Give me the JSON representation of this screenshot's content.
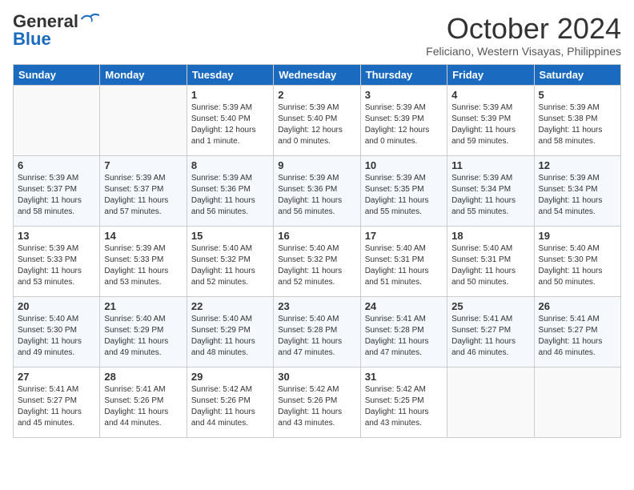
{
  "header": {
    "logo_line1": "General",
    "logo_line2": "Blue",
    "month_year": "October 2024",
    "location": "Feliciano, Western Visayas, Philippines"
  },
  "weekdays": [
    "Sunday",
    "Monday",
    "Tuesday",
    "Wednesday",
    "Thursday",
    "Friday",
    "Saturday"
  ],
  "weeks": [
    [
      {
        "day": "",
        "info": ""
      },
      {
        "day": "",
        "info": ""
      },
      {
        "day": "1",
        "info": "Sunrise: 5:39 AM\nSunset: 5:40 PM\nDaylight: 12 hours\nand 1 minute."
      },
      {
        "day": "2",
        "info": "Sunrise: 5:39 AM\nSunset: 5:40 PM\nDaylight: 12 hours\nand 0 minutes."
      },
      {
        "day": "3",
        "info": "Sunrise: 5:39 AM\nSunset: 5:39 PM\nDaylight: 12 hours\nand 0 minutes."
      },
      {
        "day": "4",
        "info": "Sunrise: 5:39 AM\nSunset: 5:39 PM\nDaylight: 11 hours\nand 59 minutes."
      },
      {
        "day": "5",
        "info": "Sunrise: 5:39 AM\nSunset: 5:38 PM\nDaylight: 11 hours\nand 58 minutes."
      }
    ],
    [
      {
        "day": "6",
        "info": "Sunrise: 5:39 AM\nSunset: 5:37 PM\nDaylight: 11 hours\nand 58 minutes."
      },
      {
        "day": "7",
        "info": "Sunrise: 5:39 AM\nSunset: 5:37 PM\nDaylight: 11 hours\nand 57 minutes."
      },
      {
        "day": "8",
        "info": "Sunrise: 5:39 AM\nSunset: 5:36 PM\nDaylight: 11 hours\nand 56 minutes."
      },
      {
        "day": "9",
        "info": "Sunrise: 5:39 AM\nSunset: 5:36 PM\nDaylight: 11 hours\nand 56 minutes."
      },
      {
        "day": "10",
        "info": "Sunrise: 5:39 AM\nSunset: 5:35 PM\nDaylight: 11 hours\nand 55 minutes."
      },
      {
        "day": "11",
        "info": "Sunrise: 5:39 AM\nSunset: 5:34 PM\nDaylight: 11 hours\nand 55 minutes."
      },
      {
        "day": "12",
        "info": "Sunrise: 5:39 AM\nSunset: 5:34 PM\nDaylight: 11 hours\nand 54 minutes."
      }
    ],
    [
      {
        "day": "13",
        "info": "Sunrise: 5:39 AM\nSunset: 5:33 PM\nDaylight: 11 hours\nand 53 minutes."
      },
      {
        "day": "14",
        "info": "Sunrise: 5:39 AM\nSunset: 5:33 PM\nDaylight: 11 hours\nand 53 minutes."
      },
      {
        "day": "15",
        "info": "Sunrise: 5:40 AM\nSunset: 5:32 PM\nDaylight: 11 hours\nand 52 minutes."
      },
      {
        "day": "16",
        "info": "Sunrise: 5:40 AM\nSunset: 5:32 PM\nDaylight: 11 hours\nand 52 minutes."
      },
      {
        "day": "17",
        "info": "Sunrise: 5:40 AM\nSunset: 5:31 PM\nDaylight: 11 hours\nand 51 minutes."
      },
      {
        "day": "18",
        "info": "Sunrise: 5:40 AM\nSunset: 5:31 PM\nDaylight: 11 hours\nand 50 minutes."
      },
      {
        "day": "19",
        "info": "Sunrise: 5:40 AM\nSunset: 5:30 PM\nDaylight: 11 hours\nand 50 minutes."
      }
    ],
    [
      {
        "day": "20",
        "info": "Sunrise: 5:40 AM\nSunset: 5:30 PM\nDaylight: 11 hours\nand 49 minutes."
      },
      {
        "day": "21",
        "info": "Sunrise: 5:40 AM\nSunset: 5:29 PM\nDaylight: 11 hours\nand 49 minutes."
      },
      {
        "day": "22",
        "info": "Sunrise: 5:40 AM\nSunset: 5:29 PM\nDaylight: 11 hours\nand 48 minutes."
      },
      {
        "day": "23",
        "info": "Sunrise: 5:40 AM\nSunset: 5:28 PM\nDaylight: 11 hours\nand 47 minutes."
      },
      {
        "day": "24",
        "info": "Sunrise: 5:41 AM\nSunset: 5:28 PM\nDaylight: 11 hours\nand 47 minutes."
      },
      {
        "day": "25",
        "info": "Sunrise: 5:41 AM\nSunset: 5:27 PM\nDaylight: 11 hours\nand 46 minutes."
      },
      {
        "day": "26",
        "info": "Sunrise: 5:41 AM\nSunset: 5:27 PM\nDaylight: 11 hours\nand 46 minutes."
      }
    ],
    [
      {
        "day": "27",
        "info": "Sunrise: 5:41 AM\nSunset: 5:27 PM\nDaylight: 11 hours\nand 45 minutes."
      },
      {
        "day": "28",
        "info": "Sunrise: 5:41 AM\nSunset: 5:26 PM\nDaylight: 11 hours\nand 44 minutes."
      },
      {
        "day": "29",
        "info": "Sunrise: 5:42 AM\nSunset: 5:26 PM\nDaylight: 11 hours\nand 44 minutes."
      },
      {
        "day": "30",
        "info": "Sunrise: 5:42 AM\nSunset: 5:26 PM\nDaylight: 11 hours\nand 43 minutes."
      },
      {
        "day": "31",
        "info": "Sunrise: 5:42 AM\nSunset: 5:25 PM\nDaylight: 11 hours\nand 43 minutes."
      },
      {
        "day": "",
        "info": ""
      },
      {
        "day": "",
        "info": ""
      }
    ]
  ]
}
